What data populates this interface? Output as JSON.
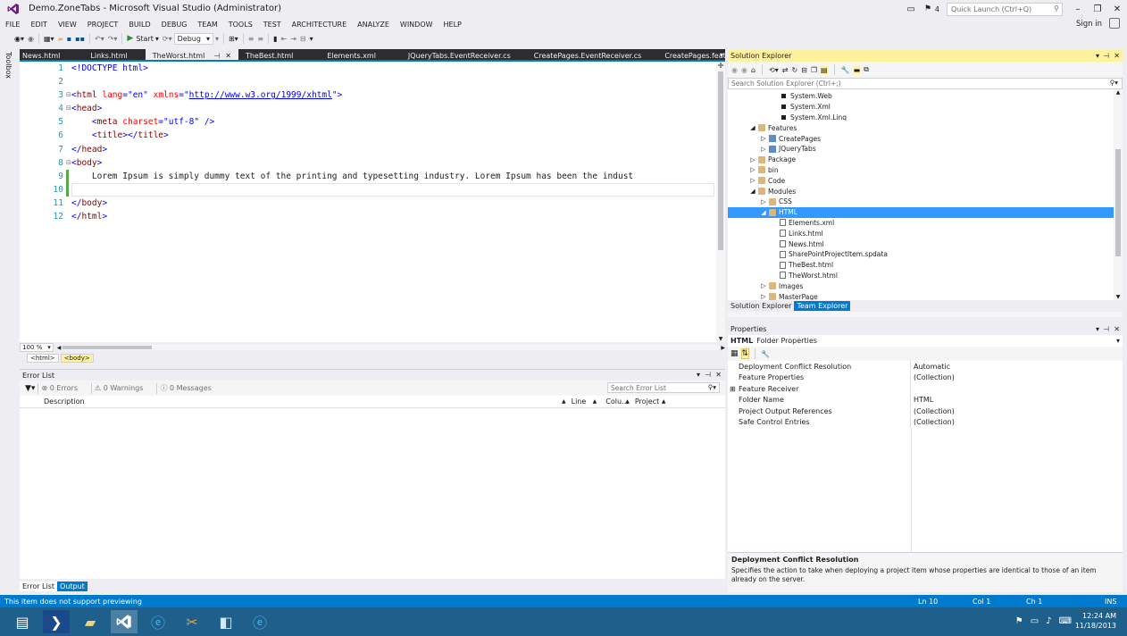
{
  "window": {
    "title": "Demo.ZoneTabs - Microsoft Visual Studio (Administrator)",
    "quick_launch_placeholder": "Quick Launch (Ctrl+Q)",
    "notification_count": "4",
    "sign_in": "Sign in"
  },
  "menu": [
    "FILE",
    "EDIT",
    "VIEW",
    "PROJECT",
    "BUILD",
    "DEBUG",
    "TEAM",
    "TOOLS",
    "TEST",
    "ARCHITECTURE",
    "ANALYZE",
    "WINDOW",
    "HELP"
  ],
  "toolbar": {
    "start_label": "Start",
    "config_value": "Debug"
  },
  "toolbox_label": "Toolbox",
  "doc_tabs": [
    "News.html",
    "Links.html",
    "TheWorst.html",
    "TheBest.html",
    "Elements.xml",
    "JQueryTabs.EventReceiver.cs",
    "CreatePages.EventReceiver.cs",
    "CreatePages.feature"
  ],
  "active_tab": "TheWorst.html",
  "editor": {
    "line_numbers": [
      "1",
      "2",
      "3",
      "4",
      "5",
      "6",
      "7",
      "8",
      "9",
      "10",
      "11",
      "12"
    ],
    "doctype": "<!DOCTYPE html>",
    "html_tag": "html",
    "lang_attr": "lang",
    "lang_val": "\"en\"",
    "xmlns_attr": "xmlns",
    "xmlns_val": "http://www.w3.org/1999/xhtml",
    "head_tag": "head",
    "meta_tag": "meta",
    "charset_attr": "charset",
    "charset_val": "\"utf-8\"",
    "title_tag": "title",
    "body_tag": "body",
    "body_text": "Lorem Ipsum is simply dummy text of the printing and typesetting industry. Lorem Ipsum has been the indust",
    "zoom": "100 %",
    "breadcrumb": [
      "<html>",
      "<body>"
    ]
  },
  "error_list": {
    "title": "Error List",
    "errors": "0 Errors",
    "warnings": "0 Warnings",
    "messages": "0 Messages",
    "search_placeholder": "Search Error List",
    "columns": [
      "Description",
      "Line",
      "Colu...",
      "Project"
    ]
  },
  "bottom_tabs": [
    "Error List",
    "Output"
  ],
  "solution_explorer": {
    "title": "Solution Explorer",
    "search_placeholder": "Search Solution Explorer (Ctrl+;)",
    "tree": [
      {
        "label": "System.Web",
        "type": "ref",
        "indent": 3
      },
      {
        "label": "System.Xml",
        "type": "ref",
        "indent": 3
      },
      {
        "label": "System.Xml.Linq",
        "type": "ref",
        "indent": 3
      },
      {
        "label": "Features",
        "type": "folder",
        "indent": 1,
        "arrow": "◢"
      },
      {
        "label": "CreatePages",
        "type": "feat",
        "indent": 2,
        "arrow": "▷"
      },
      {
        "label": "JQueryTabs",
        "type": "feat",
        "indent": 2,
        "arrow": "▷"
      },
      {
        "label": "Package",
        "type": "folder",
        "indent": 1,
        "arrow": "▷"
      },
      {
        "label": "bin",
        "type": "folder",
        "indent": 1,
        "arrow": "▷"
      },
      {
        "label": "Code",
        "type": "folder",
        "indent": 1,
        "arrow": "▷"
      },
      {
        "label": "Modules",
        "type": "folder",
        "indent": 1,
        "arrow": "◢"
      },
      {
        "label": "CSS",
        "type": "folder",
        "indent": 2,
        "arrow": "▷"
      },
      {
        "label": "HTML",
        "type": "folder",
        "indent": 2,
        "arrow": "◢",
        "selected": true
      },
      {
        "label": "Elements.xml",
        "type": "file",
        "indent": 3
      },
      {
        "label": "Links.html",
        "type": "file",
        "indent": 3
      },
      {
        "label": "News.html",
        "type": "file",
        "indent": 3
      },
      {
        "label": "SharePointProjectItem.spdata",
        "type": "file",
        "indent": 3
      },
      {
        "label": "TheBest.html",
        "type": "file",
        "indent": 3
      },
      {
        "label": "TheWorst.html",
        "type": "file",
        "indent": 3
      },
      {
        "label": "Images",
        "type": "folder",
        "indent": 2,
        "arrow": "▷"
      },
      {
        "label": "MasterPage",
        "type": "folder",
        "indent": 2,
        "arrow": "▷"
      }
    ],
    "tabs": [
      "Solution Explorer",
      "Team Explorer"
    ]
  },
  "properties": {
    "title": "Properties",
    "object_name": "HTML",
    "object_type": "Folder Properties",
    "rows": [
      {
        "name": "Deployment Conflict Resolution",
        "value": "Automatic"
      },
      {
        "name": "Feature Properties",
        "value": "(Collection)"
      },
      {
        "name": "Feature Receiver",
        "value": "",
        "expand": true
      },
      {
        "name": "Folder Name",
        "value": "HTML"
      },
      {
        "name": "Project Output References",
        "value": "(Collection)"
      },
      {
        "name": "Safe Control Entries",
        "value": "(Collection)"
      }
    ],
    "desc_title": "Deployment Conflict Resolution",
    "desc_text": "Specifies the action to take when deploying a project item whose properties are identical to those of an item already on the server."
  },
  "status": {
    "message": "This item does not support previewing",
    "ln": "Ln 10",
    "col": "Col 1",
    "ch": "Ch 1",
    "mode": "INS"
  },
  "taskbar": {
    "time": "12:24 AM",
    "date": "11/18/2013"
  },
  "colors": {
    "accent": "#007acc",
    "highlight": "#fff29d",
    "selection": "#3399ff",
    "taskbar": "#1f5f8c"
  }
}
